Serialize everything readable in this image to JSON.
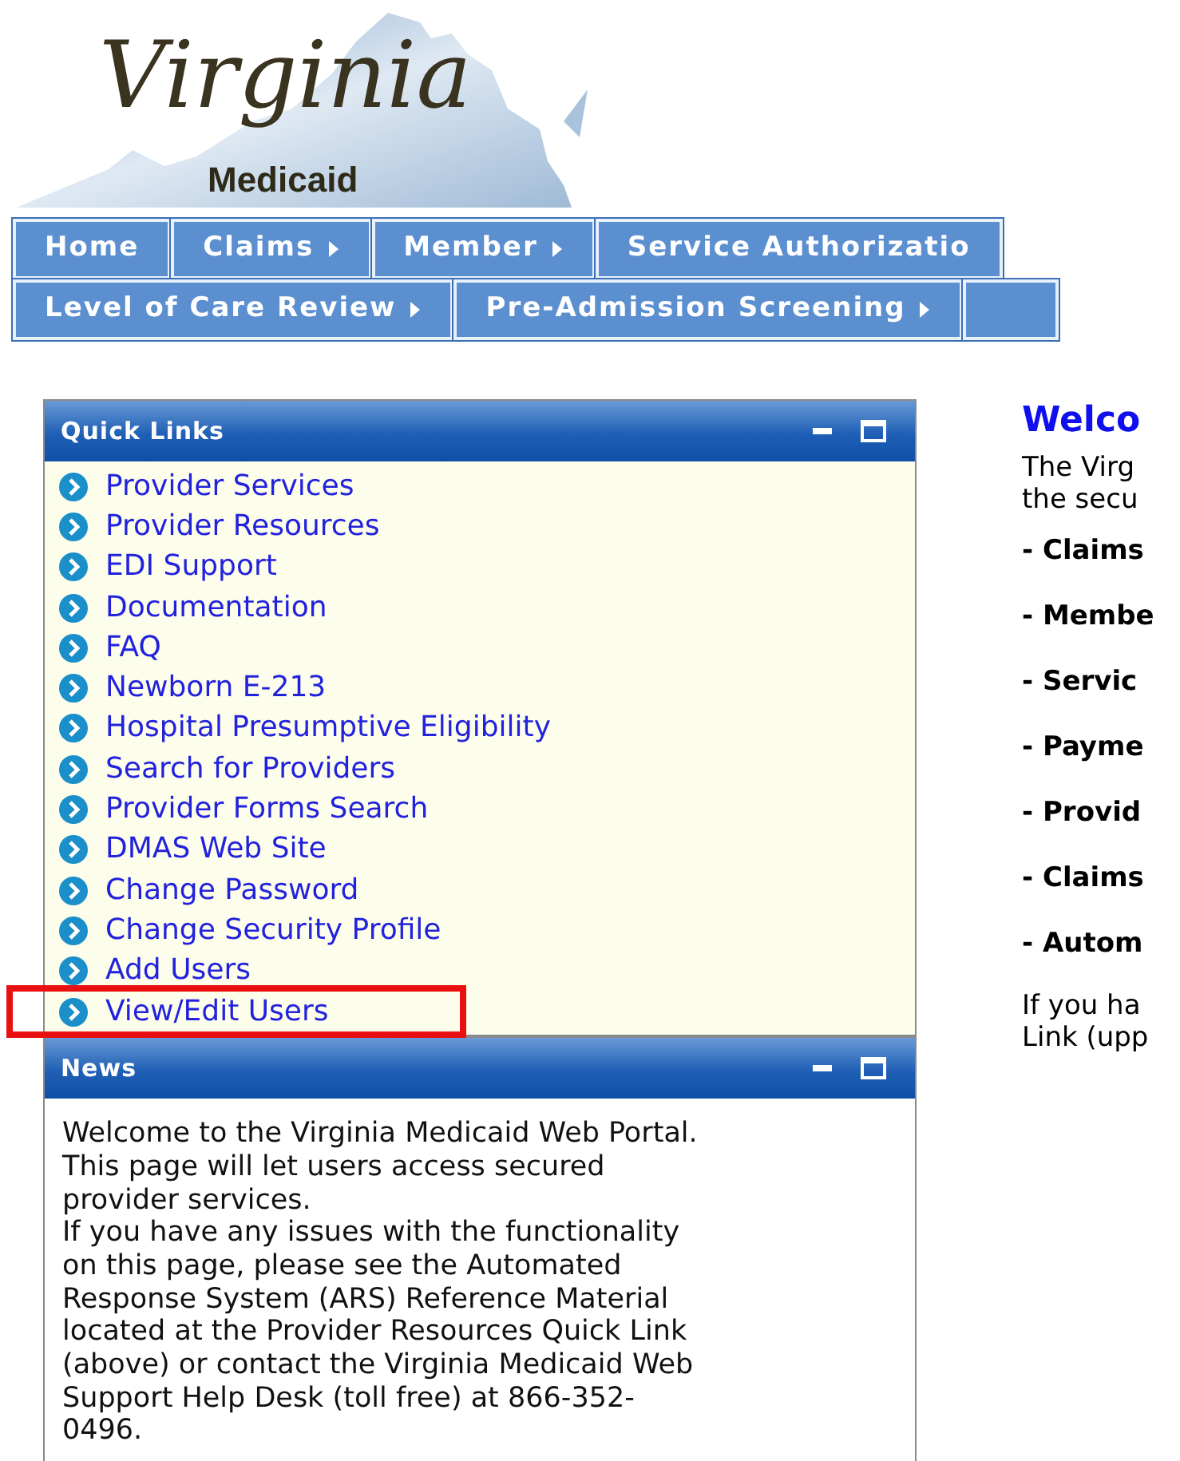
{
  "logo": {
    "title": "Virginia",
    "subtitle": "Medicaid"
  },
  "nav_rows": [
    [
      {
        "label": "Home",
        "has_submenu": false
      },
      {
        "label": "Claims",
        "has_submenu": true
      },
      {
        "label": "Member",
        "has_submenu": true
      },
      {
        "label": "Service Authorizatio",
        "has_submenu": false
      }
    ],
    [
      {
        "label": "Level of Care Review",
        "has_submenu": true
      },
      {
        "label": "Pre-Admission Screening",
        "has_submenu": true
      }
    ]
  ],
  "quick_links": {
    "title": "Quick Links",
    "items": [
      {
        "label": "Provider Services",
        "highlighted": false
      },
      {
        "label": "Provider Resources",
        "highlighted": false
      },
      {
        "label": "EDI Support",
        "highlighted": false
      },
      {
        "label": "Documentation",
        "highlighted": false
      },
      {
        "label": "FAQ",
        "highlighted": false
      },
      {
        "label": "Newborn E-213",
        "highlighted": false
      },
      {
        "label": "Hospital Presumptive Eligibility",
        "highlighted": false
      },
      {
        "label": "Search for Providers",
        "highlighted": false
      },
      {
        "label": "Provider Forms Search",
        "highlighted": false
      },
      {
        "label": "DMAS Web Site",
        "highlighted": false
      },
      {
        "label": "Change Password",
        "highlighted": false
      },
      {
        "label": "Change Security Profile",
        "highlighted": false
      },
      {
        "label": "Add Users",
        "highlighted": false
      },
      {
        "label": "View/Edit Users",
        "highlighted": true
      }
    ]
  },
  "news": {
    "title": "News",
    "lines": [
      "Welcome to the Virginia Medicaid Web Portal.",
      "This page will let users access secured",
      "provider services.",
      "If you have any issues with the functionality",
      "on this page, please see the Automated",
      "Response System (ARS) Reference Material",
      "located at the Provider Resources Quick Link",
      "(above) or contact the Virginia Medicaid Web",
      "Support Help Desk (toll free) at 866-352-",
      "0496."
    ]
  },
  "welcome": {
    "heading": "Welco",
    "intro": [
      "The Virg",
      "the secu"
    ],
    "bullets": [
      "- Claims",
      "- Membe",
      "- Servic",
      "- Payme",
      "- Provid",
      "- Claims",
      "- Autom"
    ],
    "footer": [
      "If you ha",
      "Link (upp"
    ]
  }
}
